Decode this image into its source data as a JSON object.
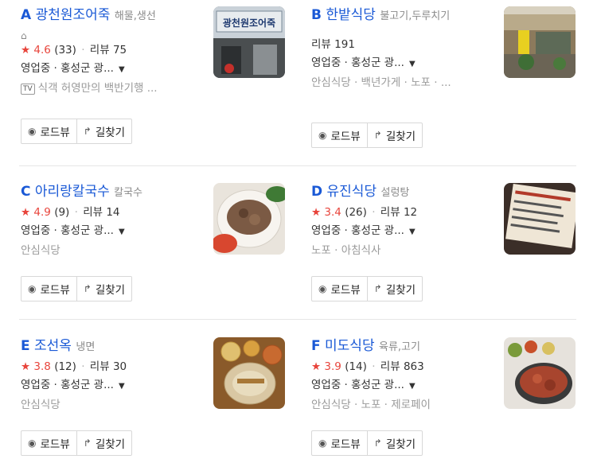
{
  "buttons": {
    "roadview": "로드뷰",
    "directions": "길찾기"
  },
  "review_prefix": "리뷰",
  "cards": [
    {
      "marker": "A",
      "name": "광천원조어죽",
      "category": "해물,생선",
      "rating": "4.6",
      "rating_count": "(33)",
      "reviews": "75",
      "status": "영업중 · 홍성군 광...",
      "tags": "식객 허영만의 백반기행 ..."
    },
    {
      "marker": "B",
      "name": "한밭식당",
      "category": "불고기,두루치기",
      "reviews": "191",
      "status": "영업중 · 홍성군 광...",
      "tags": "안심식당 · 백년가게 · 노포 · ..."
    },
    {
      "marker": "C",
      "name": "아리랑칼국수",
      "category": "칼국수",
      "rating": "4.9",
      "rating_count": "(9)",
      "reviews": "14",
      "status": "영업중 · 홍성군 광...",
      "tags": "안심식당"
    },
    {
      "marker": "D",
      "name": "유진식당",
      "category": "설렁탕",
      "rating": "3.4",
      "rating_count": "(26)",
      "reviews": "12",
      "status": "영업중 · 홍성군 광...",
      "tags": "노포 · 아침식사"
    },
    {
      "marker": "E",
      "name": "조선옥",
      "category": "냉면",
      "rating": "3.8",
      "rating_count": "(12)",
      "reviews": "30",
      "status": "영업중 · 홍성군 광...",
      "tags": "안심식당"
    },
    {
      "marker": "F",
      "name": "미도식당",
      "category": "육류,고기",
      "rating": "3.9",
      "rating_count": "(14)",
      "reviews": "863",
      "status": "영업중 · 홍성군 광...",
      "tags": "안심식당 · 노포 · 제로페이"
    }
  ],
  "thumb_sign_a": "광천원조어죽",
  "tv_badge": "TV",
  "colors": {
    "accent": "#1a59d6",
    "rating": "#e8453c"
  }
}
